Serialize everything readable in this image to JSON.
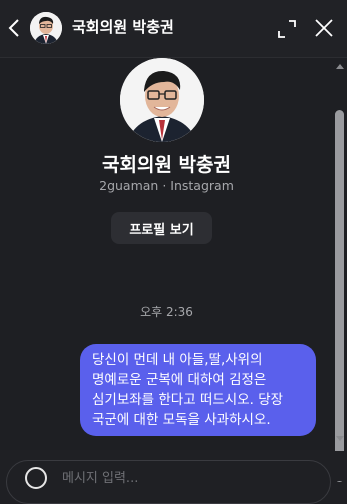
{
  "header": {
    "title": "국회의원 박충권",
    "back_icon": "chevron-left-icon",
    "expand_icon": "expand-icon",
    "close_icon": "close-icon"
  },
  "profile": {
    "name": "국회의원 박충권",
    "subtitle": "2guaman · Instagram",
    "view_button": "프로필 보기"
  },
  "messages": [
    {
      "time": "오후 2:36",
      "text": "당신이 먼데 내 아들,딸,사위의 명예로운 군복에 대하여 김정은 심기보좌를 한다고 떠드시오. 당장 국군에 대한 모독을 사과하시오.",
      "from": "me"
    }
  ],
  "composer": {
    "placeholder": "메시지 입력...",
    "emoji_icon": "emoji-icon"
  },
  "colors": {
    "background": "#1f2024",
    "bubble": "#5a60ec",
    "button": "#2d2e33"
  }
}
